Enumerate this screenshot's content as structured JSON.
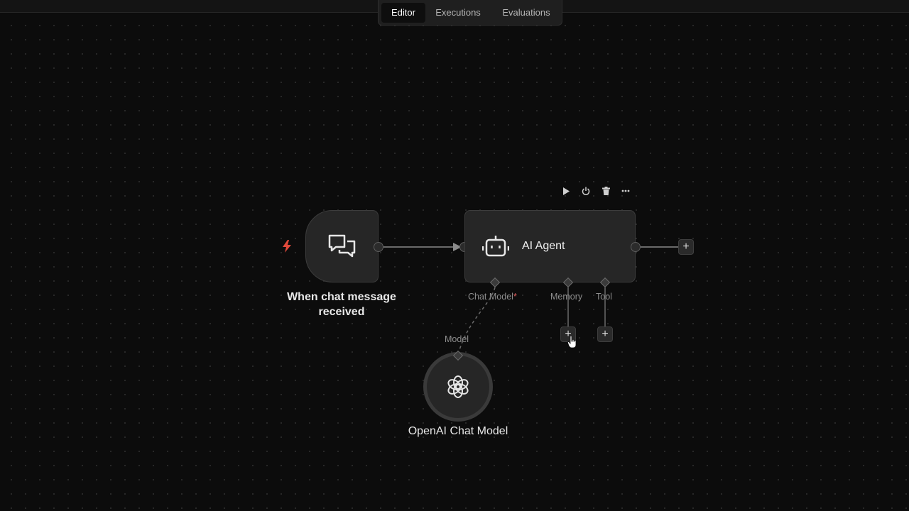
{
  "tabs": [
    {
      "label": "Editor",
      "active": true
    },
    {
      "label": "Executions",
      "active": false
    },
    {
      "label": "Evaluations",
      "active": false
    }
  ],
  "nodes": {
    "trigger": {
      "label": "When chat message received",
      "icon": "chat-bubbles-icon",
      "badge_icon": "lightning-bolt-icon",
      "badge_color": "#e0493b"
    },
    "agent": {
      "title": "AI Agent",
      "icon": "robot-icon",
      "ports": {
        "chat_model": "Chat Model",
        "required_mark": "*",
        "memory": "Memory",
        "tool": "Tool"
      },
      "toolbar": [
        "play-icon",
        "power-icon",
        "trash-icon",
        "more-icon"
      ]
    },
    "model": {
      "label": "OpenAI Chat Model",
      "port_label": "Model",
      "icon": "openai-icon"
    }
  },
  "colors": {
    "canvas": "#0c0c0c",
    "node": "#262626",
    "accent_required": "#e25d5d"
  }
}
